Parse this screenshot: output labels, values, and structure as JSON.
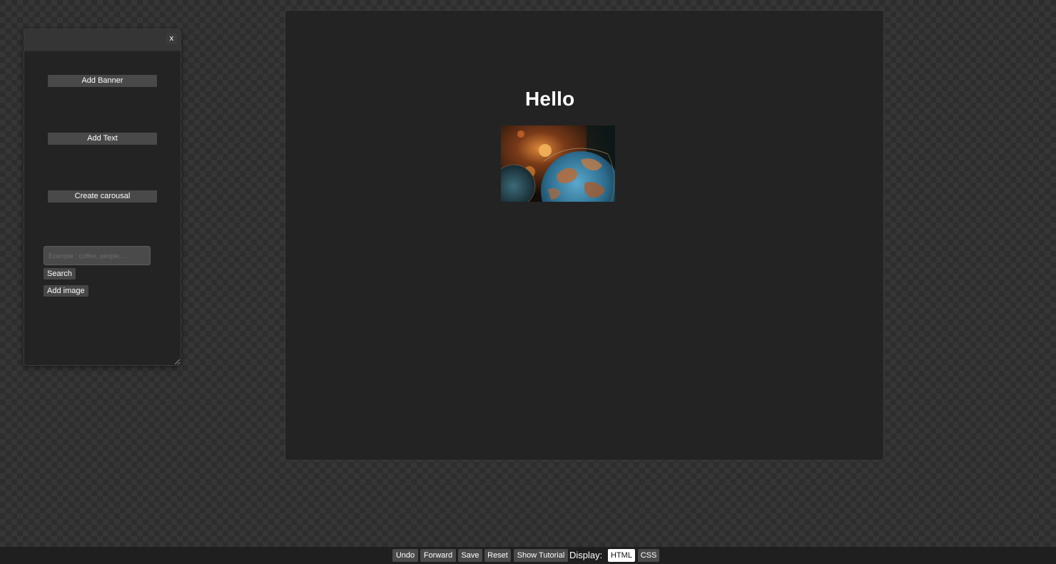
{
  "panel": {
    "close_label": "x",
    "add_banner_label": "Add Banner",
    "add_text_label": "Add Text",
    "create_carousel_label": "Create carousal",
    "search_placeholder": "Example : coffee, people, ...",
    "search_label": "Search",
    "add_image_label": "Add image"
  },
  "canvas": {
    "heading": "Hello",
    "image_icon": "globe-photo"
  },
  "toolbar": {
    "undo_label": "Undo",
    "forward_label": "Forward",
    "save_label": "Save",
    "reset_label": "Reset",
    "tutorial_label": "Show Tutorial",
    "display_label": "Display:",
    "html_label": "HTML",
    "css_label": "CSS",
    "active_display": "HTML"
  },
  "colors": {
    "background": "#2d2d2d",
    "panel": "#232323",
    "button": "#494949",
    "active_tab": "#ffffff"
  }
}
